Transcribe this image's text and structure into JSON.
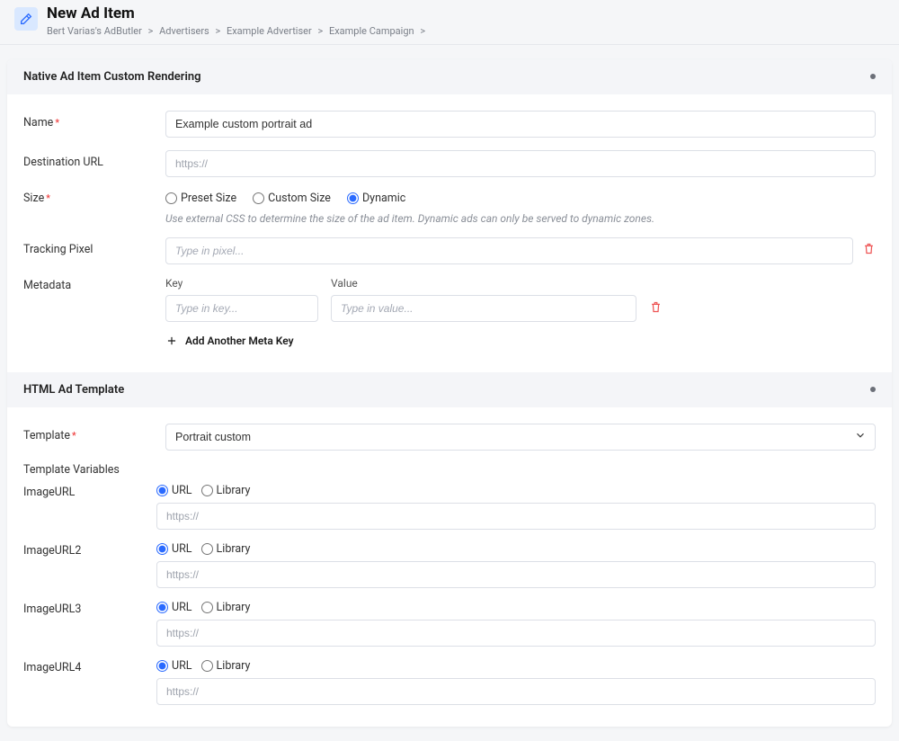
{
  "header": {
    "title": "New Ad Item",
    "breadcrumb": [
      "Bert Varias's AdButler",
      "Advertisers",
      "Example Advertiser",
      "Example Campaign"
    ]
  },
  "section1": {
    "title": "Native Ad Item Custom Rendering",
    "name_label": "Name",
    "name_value": "Example custom portrait ad",
    "dest_label": "Destination URL",
    "dest_placeholder": "https://",
    "size_label": "Size",
    "size_options": {
      "preset": "Preset Size",
      "custom": "Custom Size",
      "dynamic": "Dynamic"
    },
    "size_selected": "dynamic",
    "size_helper": "Use external CSS to determine the size of the ad item. Dynamic ads can only be served to dynamic zones.",
    "pixel_label": "Tracking Pixel",
    "pixel_placeholder": "Type in pixel...",
    "meta_label": "Metadata",
    "meta_key_label": "Key",
    "meta_value_label": "Value",
    "meta_key_placeholder": "Type in key...",
    "meta_value_placeholder": "Type in value...",
    "add_meta_label": "Add Another Meta Key"
  },
  "section2": {
    "title": "HTML Ad Template",
    "template_label": "Template",
    "template_value": "Portrait custom",
    "tv_heading": "Template Variables",
    "radio_url": "URL",
    "radio_library": "Library",
    "url_placeholder": "https://",
    "vars": [
      {
        "name": "ImageURL"
      },
      {
        "name": "ImageURL2"
      },
      {
        "name": "ImageURL3"
      },
      {
        "name": "ImageURL4"
      }
    ]
  }
}
